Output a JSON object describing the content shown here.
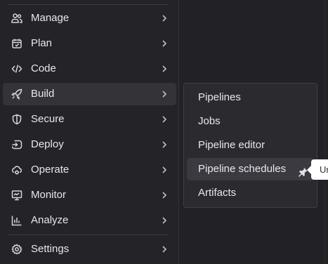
{
  "sidebar": {
    "items": [
      {
        "label": "Manage",
        "icon": "users-icon"
      },
      {
        "label": "Plan",
        "icon": "calendar-icon"
      },
      {
        "label": "Code",
        "icon": "code-icon"
      },
      {
        "label": "Build",
        "icon": "rocket-icon",
        "active": true
      },
      {
        "label": "Secure",
        "icon": "shield-icon"
      },
      {
        "label": "Deploy",
        "icon": "deploy-icon"
      },
      {
        "label": "Operate",
        "icon": "cloud-gear-icon"
      },
      {
        "label": "Monitor",
        "icon": "monitor-icon"
      },
      {
        "label": "Analyze",
        "icon": "chart-icon"
      }
    ],
    "settings": {
      "label": "Settings",
      "icon": "gear-icon"
    }
  },
  "flyout": {
    "items": [
      {
        "label": "Pipelines"
      },
      {
        "label": "Jobs"
      },
      {
        "label": "Pipeline editor"
      },
      {
        "label": "Pipeline schedules",
        "hover": true,
        "pin_icon": "pin-icon"
      },
      {
        "label": "Artifacts"
      }
    ]
  },
  "tooltip": {
    "text": "Unpin item"
  },
  "colors": {
    "background": "#222226",
    "sidebar": "#232328",
    "active_item": "#333338",
    "flyout": "#2a2a2f",
    "hover_item": "#3a3a40",
    "text": "#e8e8ec",
    "tooltip_bg": "#ffffff"
  }
}
